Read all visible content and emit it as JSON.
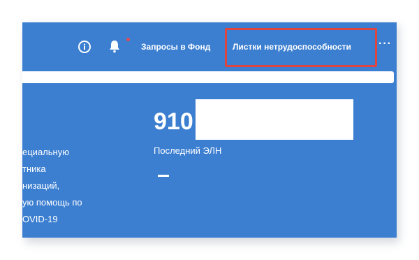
{
  "header": {
    "nav": {
      "requests_label": "Запросы в Фонд",
      "sick_leave_label": "Листки нетрудоспособности"
    },
    "more_label": "···",
    "icons": [
      "info-icon",
      "bell-icon",
      "more-icon"
    ],
    "notification_dot_color": "#e54a55",
    "highlight_color": "#e0443f"
  },
  "main": {
    "number_prefix": "910",
    "last_eln_label": "Последний ЭЛН",
    "status_value": "–",
    "left_text": [
      "ециальную",
      "тника",
      "низаций,",
      "ую помощь по",
      "OVID-19"
    ]
  },
  "theme": {
    "background": "#3c7fd1",
    "text": "#ffffff"
  }
}
